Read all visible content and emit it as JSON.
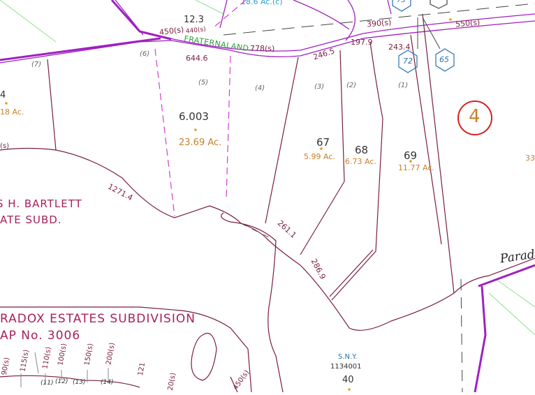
{
  "colors": {
    "parcel_line": "#7a1f3d",
    "road_line": "#a020c0",
    "road_label": "#2a9d3a",
    "acreage": "#c8802a",
    "badge": "#2a6fb0",
    "district": "#d42020",
    "subdivision_text": "#a8205c",
    "green_line": "#8fe08f"
  },
  "road": {
    "name": "FRATERNALAND"
  },
  "parcels": [
    {
      "id": "12.3"
    },
    {
      "id": "6.003",
      "acres": "23.69 Ac."
    },
    {
      "id": "67",
      "acres": "5.99 Ac."
    },
    {
      "id": "68",
      "acres": "6.73 Ac."
    },
    {
      "id": "69",
      "acres": "11.77 Ac."
    },
    {
      "id": "40",
      "owner": "S.N.Y.",
      "number": "1134001"
    }
  ],
  "partial_labels": {
    "top_acres": "18.6 Ac.(c)",
    "left_parcel": "4",
    "left_acres": "18 Ac.",
    "left_s": "(s)",
    "right_edge": "33",
    "paradox_road": "Parad"
  },
  "lot_numbers": [
    "(7)",
    "(6)",
    "(5)",
    "(4)",
    "(3)",
    "(2)",
    "(1)"
  ],
  "distances": [
    "450(s)",
    "440(s)",
    "778(s)",
    "644.6",
    "246.5",
    "197.9",
    "243.4",
    "390(s)",
    "550(s)",
    "1271.4",
    "261.1",
    "286.9"
  ],
  "badges": [
    "72",
    "65",
    "73"
  ],
  "district_number": "4",
  "subdivisions": {
    "bartlett_line1": "S H. BARTLETT",
    "bartlett_line2": "ATE SUBD.",
    "paradox_line1": "RADOX ESTATES SUBDIVISION",
    "paradox_line2": "AP No. 3006"
  },
  "bottom_labels": {
    "rot": [
      "90(s)",
      "115(s)",
      "110(s)",
      "100(s)",
      "150(s)",
      "200(s)",
      "121",
      "20(s)",
      "450(s)"
    ],
    "lots": [
      "(11)",
      "(12)",
      "(13)",
      "(14)"
    ]
  }
}
